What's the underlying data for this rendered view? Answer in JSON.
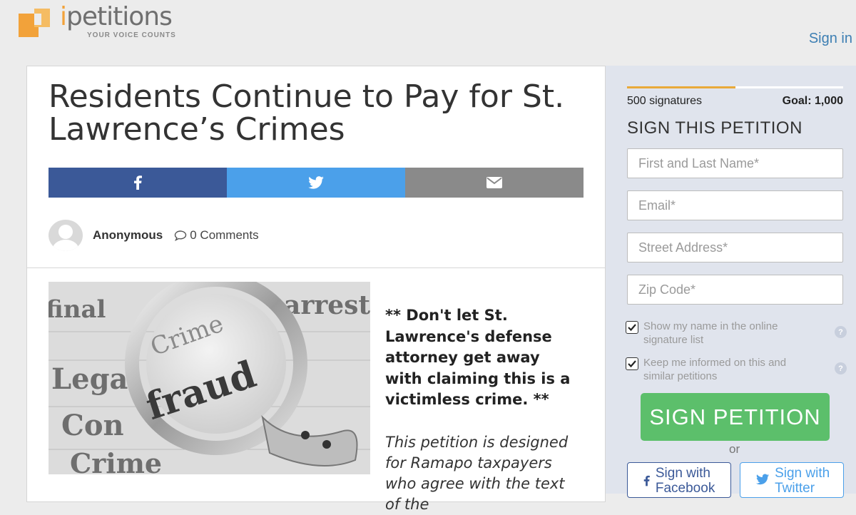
{
  "header": {
    "logo_name": "petitions",
    "logo_i": "i",
    "tagline": "YOUR VOICE COUNTS",
    "signin_label": "Sign in"
  },
  "petition": {
    "title": "Residents Continue to Pay for St. Lawrence’s Crimes",
    "author": "Anonymous",
    "comments": "0 Comments",
    "bold_text": "** Don't let St. Lawrence's defense attorney get away with claiming this is a victimless crime. **",
    "italic_text": "This petition is designed for Ramapo taxpayers who agree with the text of the"
  },
  "share": {
    "facebook_icon": "facebook-icon",
    "twitter_icon": "twitter-icon",
    "email_icon": "envelope-icon",
    "colors": {
      "facebook": "#3b5998",
      "twitter": "#4ba0ea",
      "email": "#8a8a8a"
    }
  },
  "image": {
    "words": [
      "Crime",
      "fraud",
      "arrest",
      "Legal",
      "Con",
      "Crime",
      "final"
    ]
  },
  "sidebar": {
    "signatures": "500 signatures",
    "goal": "Goal: 1,000",
    "progress_fraction": 0.5,
    "heading": "SIGN THIS PETITION",
    "fields": {
      "name_placeholder": "First and Last Name*",
      "email_placeholder": "Email*",
      "address_placeholder": "Street Address*",
      "zip_placeholder": "Zip Code*"
    },
    "checks": [
      {
        "label": "Show my name in the online signature list",
        "checked": true
      },
      {
        "label": "Keep me informed on this and similar petitions",
        "checked": true
      }
    ],
    "help_glyph": "?",
    "sign_button": "SIGN PETITION",
    "or": "or",
    "facebook_button": "Sign with Facebook",
    "twitter_button": "Sign with Twitter"
  },
  "colors": {
    "accent_orange": "#f2a23a",
    "sign_green": "#5cbf6b",
    "link_blue": "#3d7fb3"
  }
}
